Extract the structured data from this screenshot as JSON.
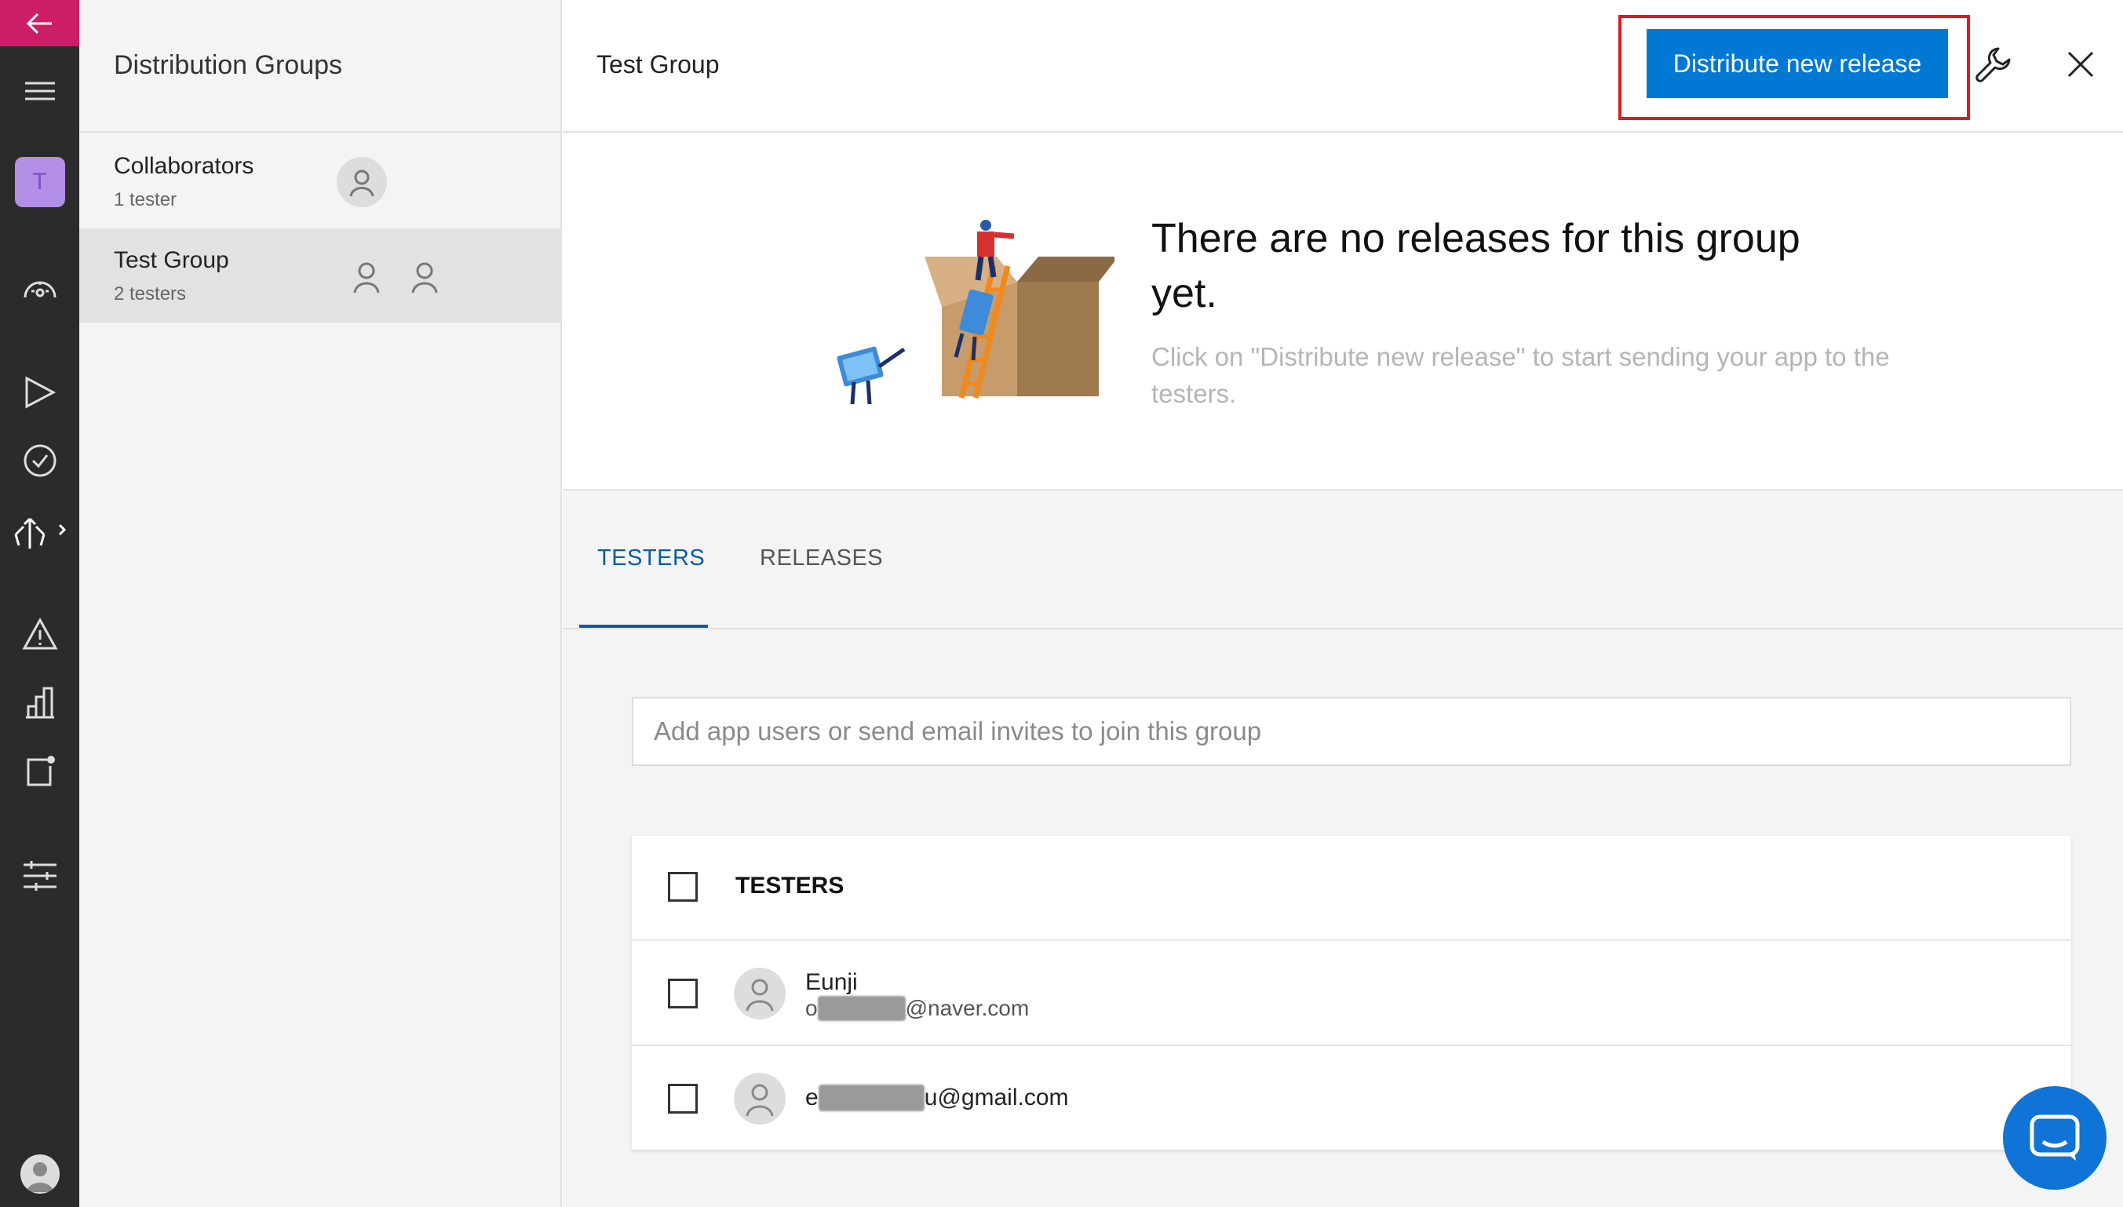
{
  "nav": {
    "app_initial": "T",
    "accent_color": "#cc1e66"
  },
  "groups_panel": {
    "title": "Distribution Groups",
    "items": [
      {
        "name": "Collaborators",
        "count": "1 tester",
        "active": false
      },
      {
        "name": "Test Group",
        "count": "2 testers",
        "active": true
      }
    ]
  },
  "header": {
    "title": "Test Group",
    "primary_button": "Distribute new release",
    "primary_color": "#0078d4",
    "icons": [
      "wrench-icon",
      "close-icon"
    ]
  },
  "empty_state": {
    "title": "There are no releases for this group yet.",
    "subtitle": "Click on \"Distribute new release\" to start sending your app to the testers."
  },
  "tabs": [
    {
      "label": "TESTERS",
      "active": true
    },
    {
      "label": "RELEASES",
      "active": false
    }
  ],
  "search": {
    "placeholder": "Add app users or send email invites to join this group"
  },
  "testers_table": {
    "header": "TESTERS",
    "rows": [
      {
        "name": "Eunji",
        "email_prefix_visible": "o",
        "email_suffix": "@naver.com"
      },
      {
        "name": "",
        "email_prefix_visible": "e",
        "email_suffix": "u@gmail.com"
      }
    ]
  }
}
